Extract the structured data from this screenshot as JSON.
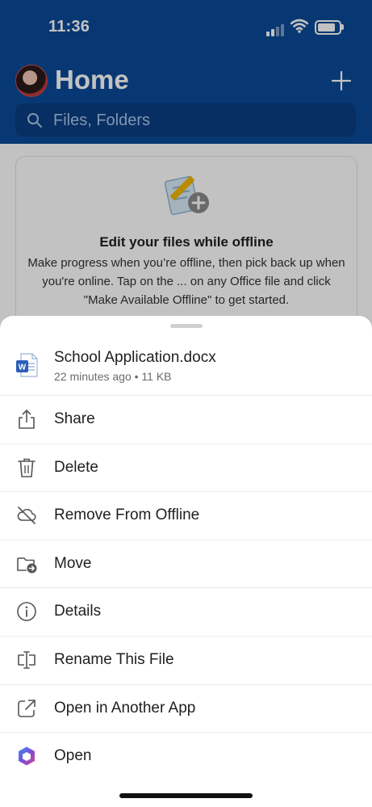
{
  "status_bar": {
    "time": "11:36"
  },
  "header": {
    "title": "Home",
    "add_icon": "plus-icon"
  },
  "search": {
    "placeholder": "Files, Folders"
  },
  "offline_card": {
    "title": "Edit your files while offline",
    "description": "Make progress when you’re offline, then pick back up when you're online. Tap on the ... on any Office file and click \"Make Available Offline\" to get started."
  },
  "sheet": {
    "file": {
      "name": "School Application.docx",
      "meta": "22 minutes ago • 11 KB"
    },
    "actions": [
      {
        "label": "Share",
        "icon": "share-icon"
      },
      {
        "label": "Delete",
        "icon": "trash-icon"
      },
      {
        "label": "Remove From Offline",
        "icon": "cloud-off-icon"
      },
      {
        "label": "Move",
        "icon": "folder-move-icon"
      },
      {
        "label": "Details",
        "icon": "info-icon"
      },
      {
        "label": "Rename This File",
        "icon": "rename-icon"
      },
      {
        "label": "Open in Another App",
        "icon": "open-external-icon"
      },
      {
        "label": "Open",
        "icon": "office-app-icon"
      }
    ]
  },
  "colors": {
    "header_bg": "#0b4a97",
    "search_bg": "#0a3f83",
    "word_blue": "#2b5eb8"
  }
}
